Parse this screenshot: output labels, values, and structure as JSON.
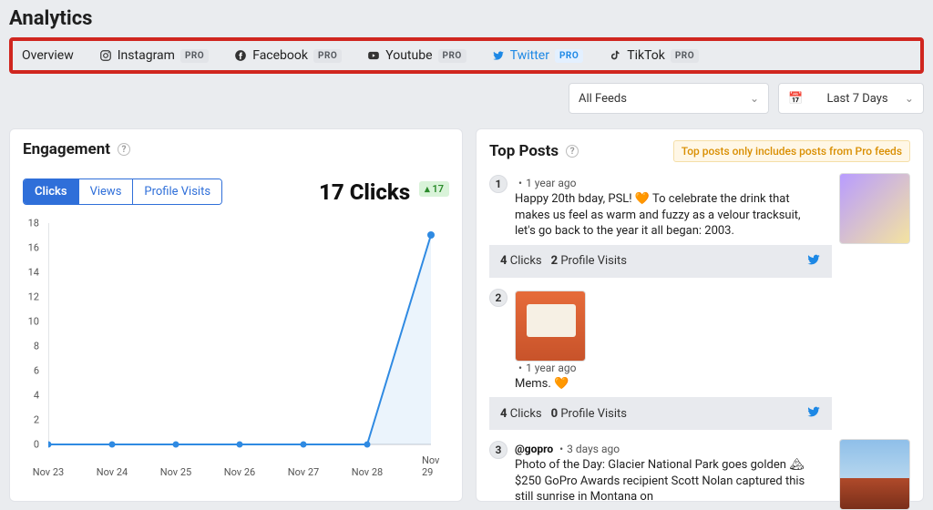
{
  "page_title": "Analytics",
  "tabs": [
    {
      "label": "Overview",
      "pro": false,
      "icon": null
    },
    {
      "label": "Instagram",
      "pro": true,
      "badge": "PRO",
      "icon": "instagram"
    },
    {
      "label": "Facebook",
      "pro": true,
      "badge": "PRO",
      "icon": "facebook"
    },
    {
      "label": "Youtube",
      "pro": true,
      "badge": "PRO",
      "icon": "youtube"
    },
    {
      "label": "Twitter",
      "pro": true,
      "badge": "PRO",
      "icon": "twitter",
      "highlight": true
    },
    {
      "label": "TikTok",
      "pro": true,
      "badge": "PRO",
      "icon": "tiktok"
    }
  ],
  "filters": {
    "feeds_label": "All Feeds",
    "date_label": "Last 7 Days"
  },
  "engagement": {
    "title": "Engagement",
    "segments": [
      "Clicks",
      "Views",
      "Profile Visits"
    ],
    "active_segment": 0,
    "metric_text": "17 Clicks",
    "delta_text": "▴ 17"
  },
  "chart_data": {
    "type": "line",
    "title": "Engagement — Clicks",
    "xlabel": "",
    "ylabel": "",
    "ylim": [
      0,
      18
    ],
    "yticks": [
      0,
      2,
      4,
      6,
      8,
      10,
      12,
      14,
      16,
      18
    ],
    "categories": [
      "Nov 23",
      "Nov 24",
      "Nov 25",
      "Nov 26",
      "Nov 27",
      "Nov 28",
      "Nov 29"
    ],
    "values": [
      0,
      0,
      0,
      0,
      0,
      0,
      17
    ]
  },
  "top_posts": {
    "title": "Top Posts",
    "notice": "Top posts only includes posts from Pro feeds",
    "posts": [
      {
        "rank": "1",
        "author": "",
        "time": "1 year ago",
        "text": "Happy 20th bday, PSL! 🧡 To celebrate the drink that makes us feel as warm and fuzzy as a velour tracksuit, let's go back to the year it all began: 2003.",
        "clicks": "4",
        "clicks_label": "Clicks",
        "visits": "2",
        "visits_label": "Profile Visits",
        "platform": "twitter",
        "thumb": "psl"
      },
      {
        "rank": "2",
        "author": "",
        "time": "1 year ago",
        "text": "Mems. 🧡",
        "clicks": "4",
        "clicks_label": "Clicks",
        "visits": "0",
        "visits_label": "Profile Visits",
        "platform": "twitter",
        "thumb": "phone"
      },
      {
        "rank": "3",
        "author": "@gopro",
        "time": "3 days ago",
        "text": "Photo of the Day: Glacier National Park goes golden 🏔 $250 GoPro Awards recipient Scott Nolan captured this still sunrise in Montana on",
        "clicks": "",
        "clicks_label": "",
        "visits": "",
        "visits_label": "",
        "platform": "twitter",
        "thumb": "sun"
      }
    ]
  }
}
